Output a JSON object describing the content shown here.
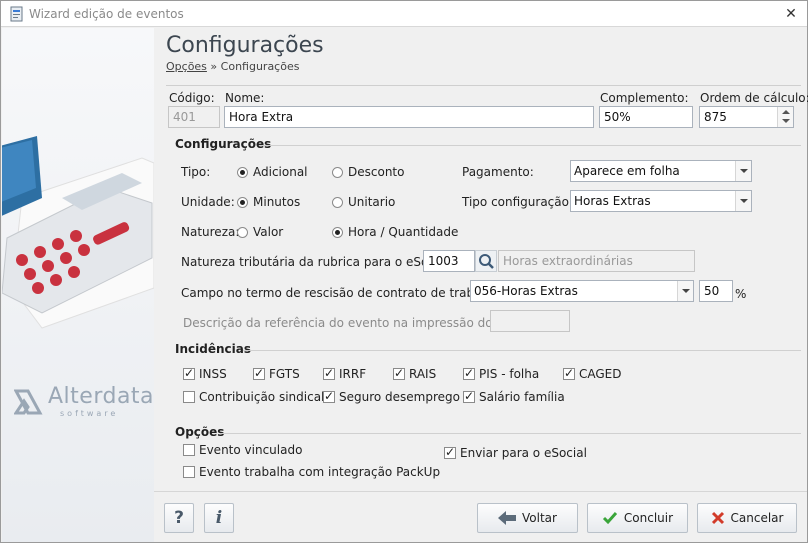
{
  "window": {
    "title": "Wizard edição de eventos",
    "close_icon": "close-icon"
  },
  "brand": {
    "logo_text": "Alterdata",
    "logo_sub": "software"
  },
  "header": {
    "title": "Configurações",
    "breadcrumb_link": "Opções",
    "breadcrumb_sep": "»",
    "breadcrumb_current": "Configurações"
  },
  "top_fields": {
    "codigo_label": "Código:",
    "codigo_value": "401",
    "nome_label": "Nome:",
    "nome_value": "Hora Extra",
    "complemento_label": "Complemento:",
    "complemento_value": "50%",
    "ordem_label": "Ordem de cálculo:",
    "ordem_value": "875"
  },
  "config": {
    "section": "Configurações",
    "tipo_label": "Tipo:",
    "tipo_adicional": "Adicional",
    "tipo_desconto": "Desconto",
    "unidade_label": "Unidade:",
    "unidade_minutos": "Minutos",
    "unidade_unitario": "Unitario",
    "natureza_label": "Natureza:",
    "natureza_valor": "Valor",
    "natureza_hora": "Hora / Quantidade",
    "pagamento_label": "Pagamento:",
    "pagamento_value": "Aparece em folha",
    "tipo_config_label": "Tipo configuração:",
    "tipo_config_value": "Horas Extras",
    "natureza_trib_label": "Natureza tributária da rubrica para o eSocial:",
    "natureza_trib_code": "1003",
    "natureza_trib_desc": "Horas extraordinárias",
    "campo_label": "Campo no termo de rescisão de contrato de trabalho:",
    "campo_value": "056-Horas Extras",
    "campo_percent": "50",
    "percent_sign": "%",
    "descricao_label": "Descrição da referência do evento na impressão do TRCT:"
  },
  "incidencias": {
    "section": "Incidências",
    "items": [
      {
        "label": "INSS",
        "checked": true
      },
      {
        "label": "FGTS",
        "checked": true
      },
      {
        "label": "IRRF",
        "checked": true
      },
      {
        "label": "RAIS",
        "checked": true
      },
      {
        "label": "PIS - folha",
        "checked": true
      },
      {
        "label": "CAGED",
        "checked": true
      },
      {
        "label": "Contribuição sindical",
        "checked": false
      },
      {
        "label": "Seguro desemprego",
        "checked": true
      },
      {
        "label": "Salário família",
        "checked": true
      }
    ]
  },
  "opcoes": {
    "section": "Opções",
    "evento_vinculado": "Evento vinculado",
    "packup": "Evento trabalha com integração PackUp",
    "esocial": "Enviar para o eSocial"
  },
  "footer": {
    "help_label": "?",
    "info_label": "i",
    "voltar": "Voltar",
    "concluir": "Concluir",
    "cancelar": "Cancelar"
  },
  "colors": {
    "accent_green": "#3aa53a",
    "accent_red": "#d23b2a",
    "back_arrow": "#5c6b7a"
  }
}
